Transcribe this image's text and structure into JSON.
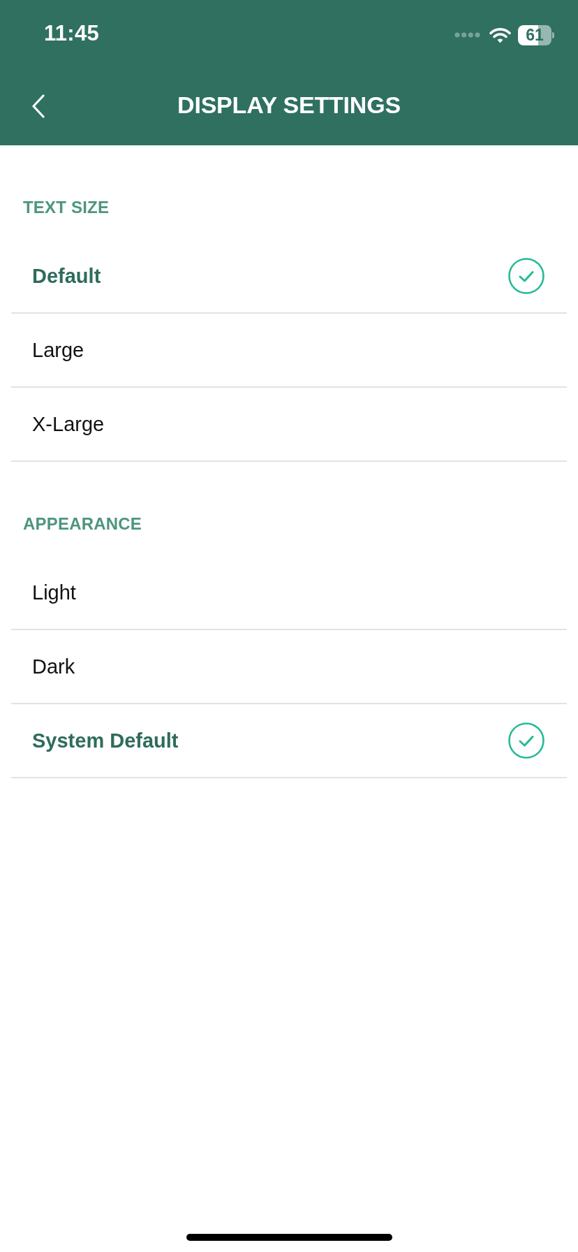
{
  "status_bar": {
    "time": "11:45",
    "battery": "61"
  },
  "header": {
    "title": "DISPLAY SETTINGS"
  },
  "sections": [
    {
      "title": "TEXT SIZE",
      "options": [
        {
          "label": "Default",
          "selected": true
        },
        {
          "label": "Large",
          "selected": false
        },
        {
          "label": "X-Large",
          "selected": false
        }
      ]
    },
    {
      "title": "APPEARANCE",
      "options": [
        {
          "label": "Light",
          "selected": false
        },
        {
          "label": "Dark",
          "selected": false
        },
        {
          "label": "System Default",
          "selected": true
        }
      ]
    }
  ]
}
